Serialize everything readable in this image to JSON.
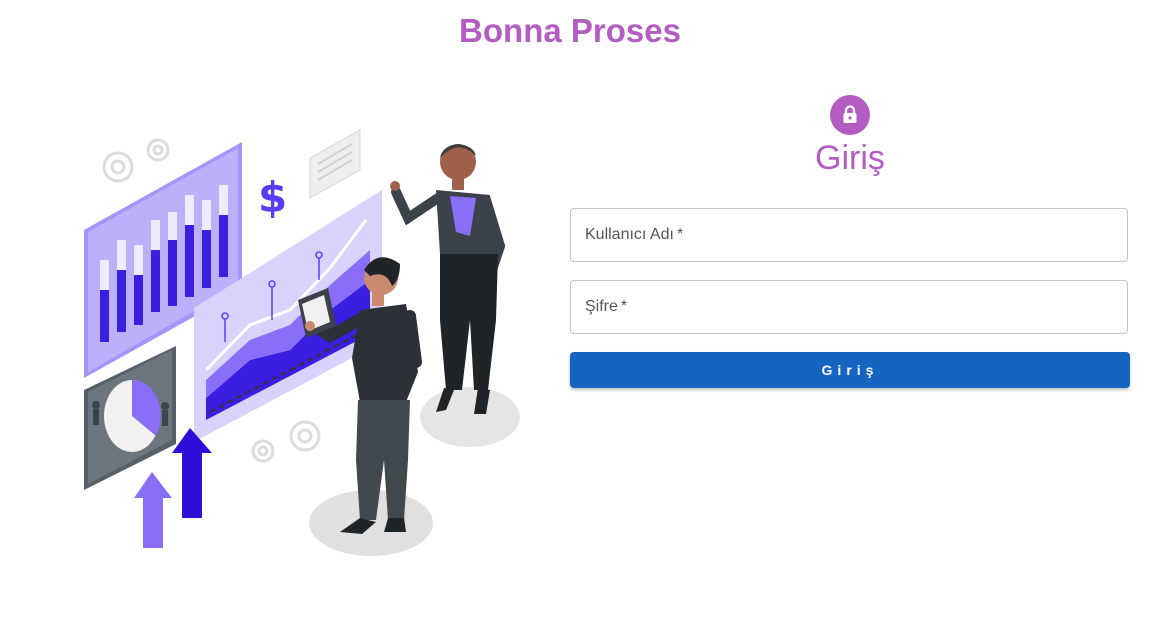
{
  "brand": {
    "title": "Bonna Proses"
  },
  "login": {
    "title": "Giriş",
    "username": {
      "label": "Kullanıcı Adı",
      "required_mark": "*"
    },
    "password": {
      "label": "Şifre",
      "required_mark": "*"
    },
    "submit_label": "Giriş",
    "icon": "lock-icon"
  },
  "illustration": {
    "icon": "business-analytics-illustration",
    "symbol": "$"
  },
  "colors": {
    "accent": "#b35cc2",
    "primary_button": "#1565c0",
    "illustration_purple": "#7b5cf0",
    "illustration_dark": "#2b0fd6"
  }
}
